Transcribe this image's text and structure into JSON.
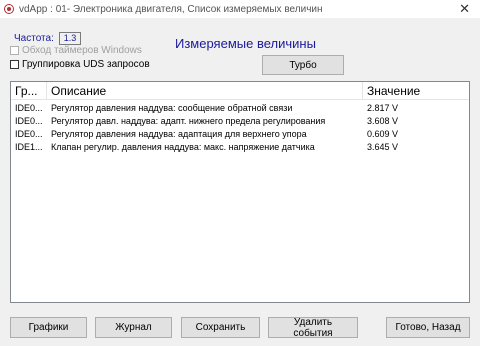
{
  "window": {
    "title": "vdApp : 01- Электроника двигателя,  Список измеряемых величин",
    "close_glyph": "✕"
  },
  "frequency": {
    "label": "Частота:",
    "value": "1.3"
  },
  "options": {
    "bypass_timers_label": "Обход таймеров Windows",
    "uds_grouping_label": "Группировка UDS запросов"
  },
  "section_title": "Измеряемые величины",
  "turbo_button_label": "Турбо",
  "table": {
    "columns": [
      "Гр...",
      "Описание",
      "Значение"
    ],
    "rows": [
      {
        "group": "IDE0...",
        "description": "Регулятор давления наддува: сообщение обратной связи",
        "value": "2.817 V"
      },
      {
        "group": "IDE0...",
        "description": "Регулятор давл. наддува: адапт. нижнего предела регулирования",
        "value": "3.608 V"
      },
      {
        "group": "IDE0...",
        "description": "Регулятор давления наддува: адаптация для верхнего упора",
        "value": "0.609 V"
      },
      {
        "group": "IDE1...",
        "description": "Клапан регулир. давления наддува: макс. напряжение датчика",
        "value": "3.645 V"
      }
    ]
  },
  "footer": {
    "graphs_label": "Графики",
    "log_label": "Журнал",
    "save_label": "Сохранить",
    "delete_events_label": "Удалить события",
    "done_back_label": "Готово, Назад"
  }
}
